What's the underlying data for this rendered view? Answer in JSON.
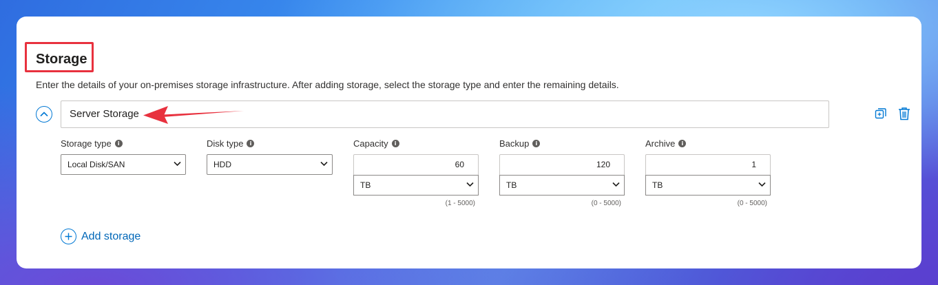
{
  "section": {
    "title": "Storage",
    "description": "Enter the details of your on-premises storage infrastructure. After adding storage, select the storage type and enter the remaining details."
  },
  "storage_item": {
    "name": "Server Storage",
    "fields": {
      "storage_type": {
        "label": "Storage type",
        "value": "Local Disk/SAN"
      },
      "disk_type": {
        "label": "Disk type",
        "value": "HDD"
      },
      "capacity": {
        "label": "Capacity",
        "value": "60",
        "unit": "TB",
        "range": "(1 - 5000)"
      },
      "backup": {
        "label": "Backup",
        "value": "120",
        "unit": "TB",
        "range": "(0 - 5000)"
      },
      "archive": {
        "label": "Archive",
        "value": "1",
        "unit": "TB",
        "range": "(0 - 5000)"
      }
    }
  },
  "actions": {
    "add_storage": "Add storage"
  },
  "icons": {
    "collapse": "chevron-up-icon",
    "copy": "copy-icon",
    "delete": "trash-icon",
    "info": "info-icon",
    "add": "plus-circle-icon",
    "annotation_arrow": "red-arrow-icon"
  },
  "colors": {
    "accent": "#0078d4",
    "highlight": "#e8313e"
  }
}
